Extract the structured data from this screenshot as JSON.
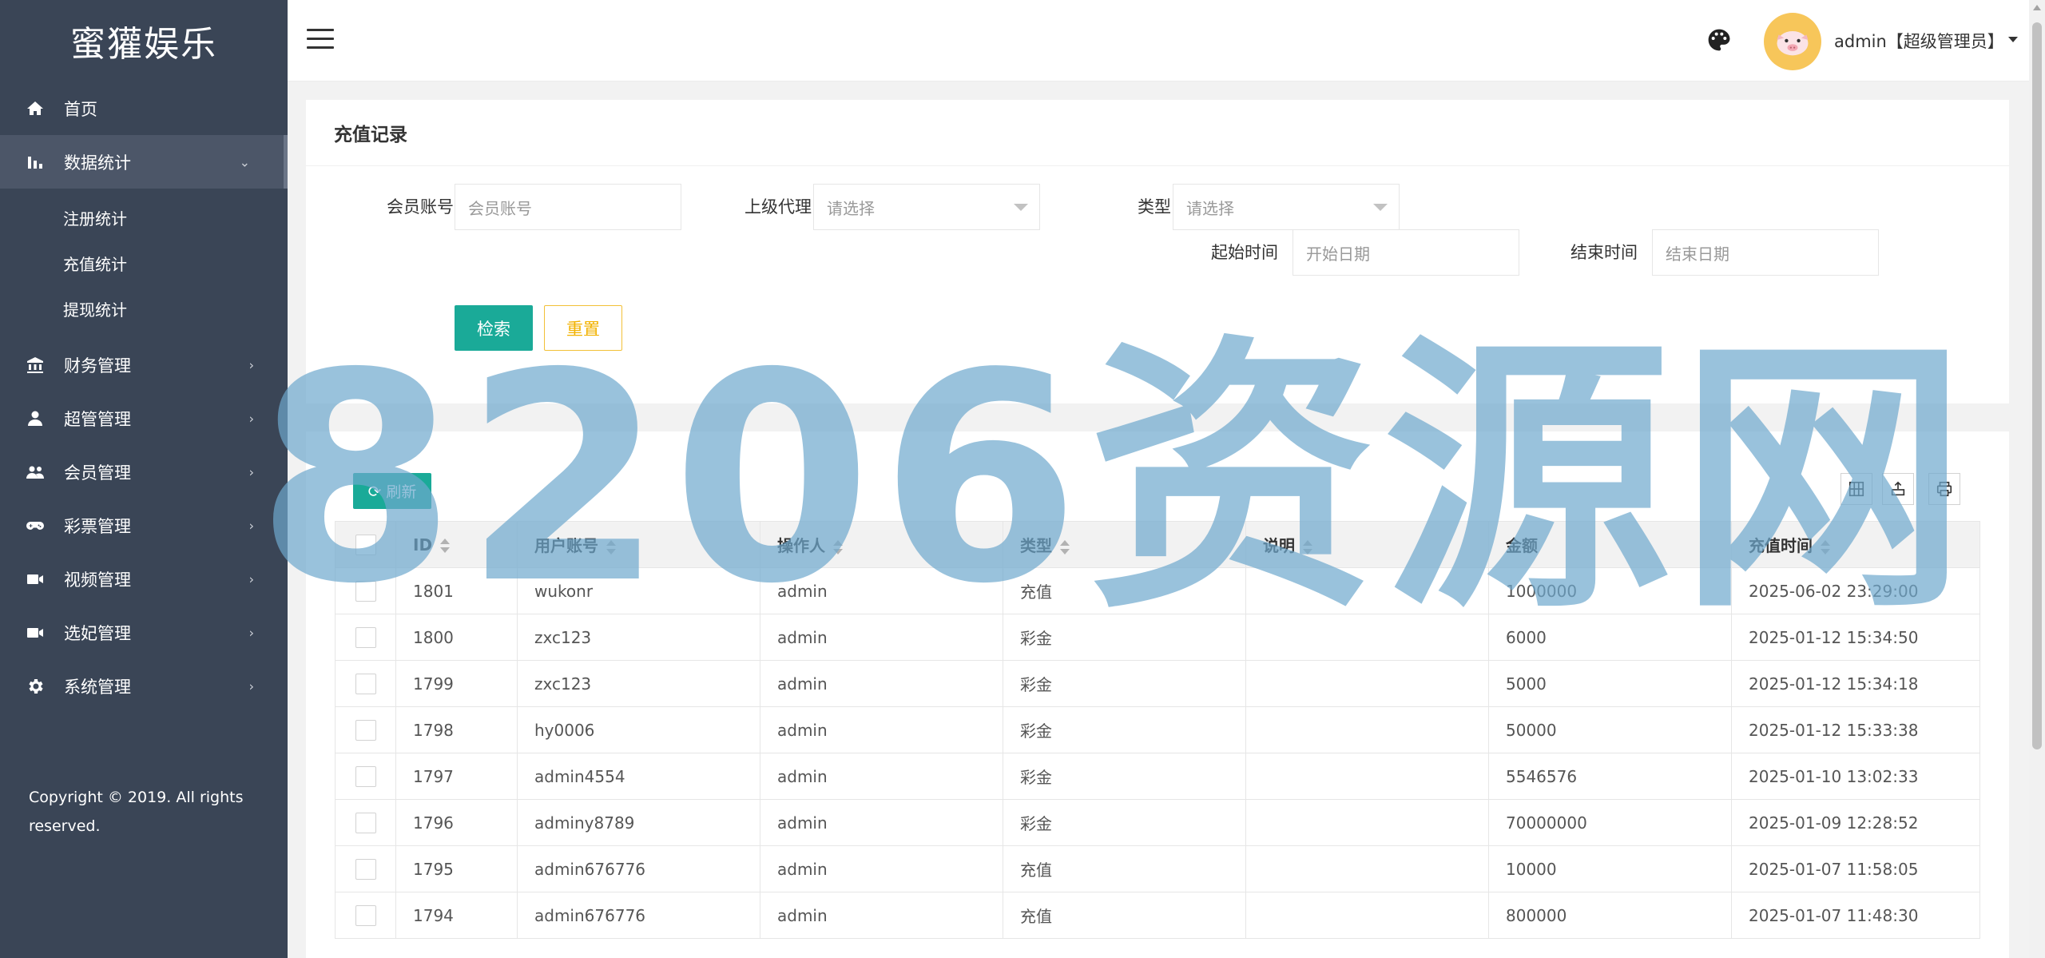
{
  "sidebar": {
    "logo": "蜜獾娱乐",
    "items": [
      {
        "label": "首页",
        "icon": "home-icon",
        "arrow": ""
      },
      {
        "label": "数据统计",
        "icon": "bar-chart-icon",
        "arrow": "⌄"
      },
      {
        "label": "财务管理",
        "icon": "bank-icon",
        "arrow": "›"
      },
      {
        "label": "超管管理",
        "icon": "user-icon",
        "arrow": "›"
      },
      {
        "label": "会员管理",
        "icon": "users-icon",
        "arrow": "›"
      },
      {
        "label": "彩票管理",
        "icon": "gamepad-icon",
        "arrow": "›"
      },
      {
        "label": "视频管理",
        "icon": "video-icon",
        "arrow": "›"
      },
      {
        "label": "选妃管理",
        "icon": "video-icon",
        "arrow": "›"
      },
      {
        "label": "系统管理",
        "icon": "gear-icon",
        "arrow": "›"
      }
    ],
    "subitems": [
      "注册统计",
      "充值统计",
      "提现统计"
    ],
    "copyright": "Copyright © 2019. All rights reserved."
  },
  "header": {
    "user": "admin【超级管理员】"
  },
  "search": {
    "title": "充值记录",
    "member_label": "会员账号",
    "member_placeholder": "会员账号",
    "agent_label": "上级代理",
    "agent_value": "请选择",
    "type_label": "类型",
    "type_value": "请选择",
    "start_label": "起始时间",
    "start_placeholder": "开始日期",
    "end_label": "结束时间",
    "end_placeholder": "结束日期",
    "search_btn": "检索",
    "reset_btn": "重置"
  },
  "table": {
    "refresh_btn": "刷新",
    "columns": [
      "ID",
      "用户账号",
      "操作人",
      "类型",
      "说明",
      "金额",
      "充值时间"
    ],
    "rows": [
      {
        "id": "1801",
        "user": "wukonr",
        "op": "admin",
        "type": "充值",
        "type_kind": "recharge",
        "desc": "",
        "amount": "1000000",
        "time": "2025-06-02 23:29:00"
      },
      {
        "id": "1800",
        "user": "zxc123",
        "op": "admin",
        "type": "彩金",
        "type_kind": "bonus",
        "desc": "",
        "amount": "6000",
        "time": "2025-01-12 15:34:50"
      },
      {
        "id": "1799",
        "user": "zxc123",
        "op": "admin",
        "type": "彩金",
        "type_kind": "bonus",
        "desc": "",
        "amount": "5000",
        "time": "2025-01-12 15:34:18"
      },
      {
        "id": "1798",
        "user": "hy0006",
        "op": "admin",
        "type": "彩金",
        "type_kind": "bonus",
        "desc": "",
        "amount": "50000",
        "time": "2025-01-12 15:33:38"
      },
      {
        "id": "1797",
        "user": "admin4554",
        "op": "admin",
        "type": "彩金",
        "type_kind": "bonus",
        "desc": "",
        "amount": "5546576",
        "time": "2025-01-10 13:02:33"
      },
      {
        "id": "1796",
        "user": "adminy8789",
        "op": "admin",
        "type": "彩金",
        "type_kind": "bonus",
        "desc": "",
        "amount": "70000000",
        "time": "2025-01-09 12:28:52"
      },
      {
        "id": "1795",
        "user": "admin676776",
        "op": "admin",
        "type": "充值",
        "type_kind": "recharge",
        "desc": "",
        "amount": "10000",
        "time": "2025-01-07 11:58:05"
      },
      {
        "id": "1794",
        "user": "admin676776",
        "op": "admin",
        "type": "充值",
        "type_kind": "recharge",
        "desc": "",
        "amount": "800000",
        "time": "2025-01-07 11:48:30"
      }
    ]
  },
  "watermark": "8206资源网",
  "colors": {
    "sidebar_bg": "#3a4556",
    "primary": "#1aaa98",
    "warning": "#f2b800",
    "recharge": "#2b8a2b"
  }
}
